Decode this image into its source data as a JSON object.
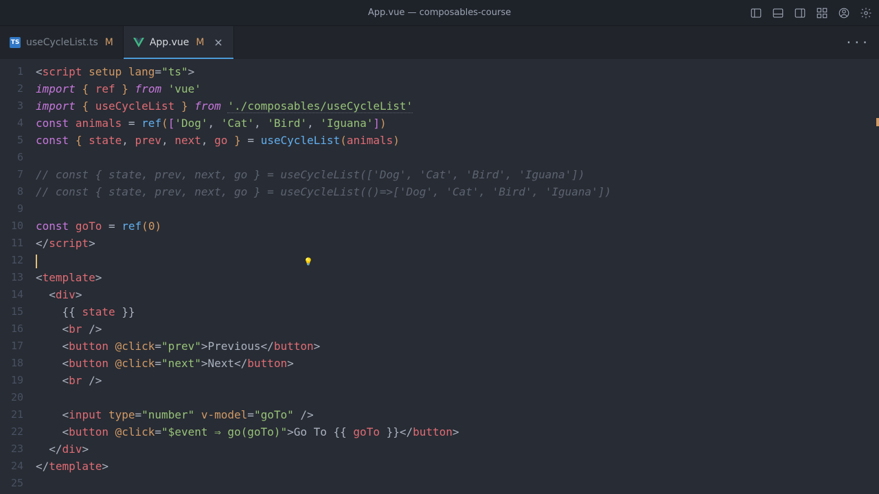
{
  "titlebar": {
    "title": "App.vue — composables-course"
  },
  "tabs": [
    {
      "name": "useCycleList.ts",
      "modified": "M",
      "active": false,
      "lang": "ts"
    },
    {
      "name": "App.vue",
      "modified": "M",
      "active": true,
      "lang": "vue"
    }
  ],
  "gutter_lines": [
    "1",
    "2",
    "3",
    "4",
    "5",
    "6",
    "7",
    "8",
    "9",
    "10",
    "11",
    "12",
    "13",
    "14",
    "15",
    "16",
    "17",
    "18",
    "19",
    "20",
    "21",
    "22",
    "23",
    "24",
    "25"
  ],
  "code": {
    "l1": {
      "script": "script",
      "setup": "setup",
      "lang_attr": "lang",
      "eq": "=",
      "lang_val": "\"ts\""
    },
    "l2": {
      "import": "import",
      "ref": "ref",
      "from": "from",
      "vue": "'vue'"
    },
    "l3": {
      "import": "import",
      "useCycleList": "useCycleList",
      "from": "from",
      "path": "'./composables/useCycleList'"
    },
    "l4": {
      "const": "const",
      "animals": "animals",
      "eq": "=",
      "ref": "ref",
      "dog": "'Dog'",
      "cat": "'Cat'",
      "bird": "'Bird'",
      "iguana": "'Iguana'"
    },
    "l5": {
      "const": "const",
      "state": "state",
      "prev": "prev",
      "next": "next",
      "go": "go",
      "eq": "=",
      "useCycleList": "useCycleList",
      "animals": "animals"
    },
    "l7": "// const { state, prev, next, go } = useCycleList(['Dog', 'Cat', 'Bird', 'Iguana'])",
    "l8": "// const { state, prev, next, go } = useCycleList(()=>['Dog', 'Cat', 'Bird', 'Iguana'])",
    "l10": {
      "const": "const",
      "goTo": "goTo",
      "eq": "=",
      "ref": "ref",
      "zero": "0"
    },
    "l11": {
      "script": "script"
    },
    "l13": {
      "template": "template"
    },
    "l14": {
      "div": "div"
    },
    "l15": {
      "state": "state"
    },
    "l16": {
      "br": "br"
    },
    "l17": {
      "button": "button",
      "click": "@click",
      "prev": "\"prev\"",
      "text": "Previous"
    },
    "l18": {
      "button": "button",
      "click": "@click",
      "next": "\"next\"",
      "text": "Next"
    },
    "l19": {
      "br": "br"
    },
    "l21": {
      "input": "input",
      "type_attr": "type",
      "number": "\"number\"",
      "vmodel": "v-model",
      "goTo": "\"goTo\""
    },
    "l22": {
      "button": "button",
      "click": "@click",
      "handler": "\"$event ⇒ go(goTo)\"",
      "text1": "Go To ",
      "goTo": "goTo"
    },
    "l23": {
      "div": "div"
    },
    "l24": {
      "template": "template"
    }
  }
}
